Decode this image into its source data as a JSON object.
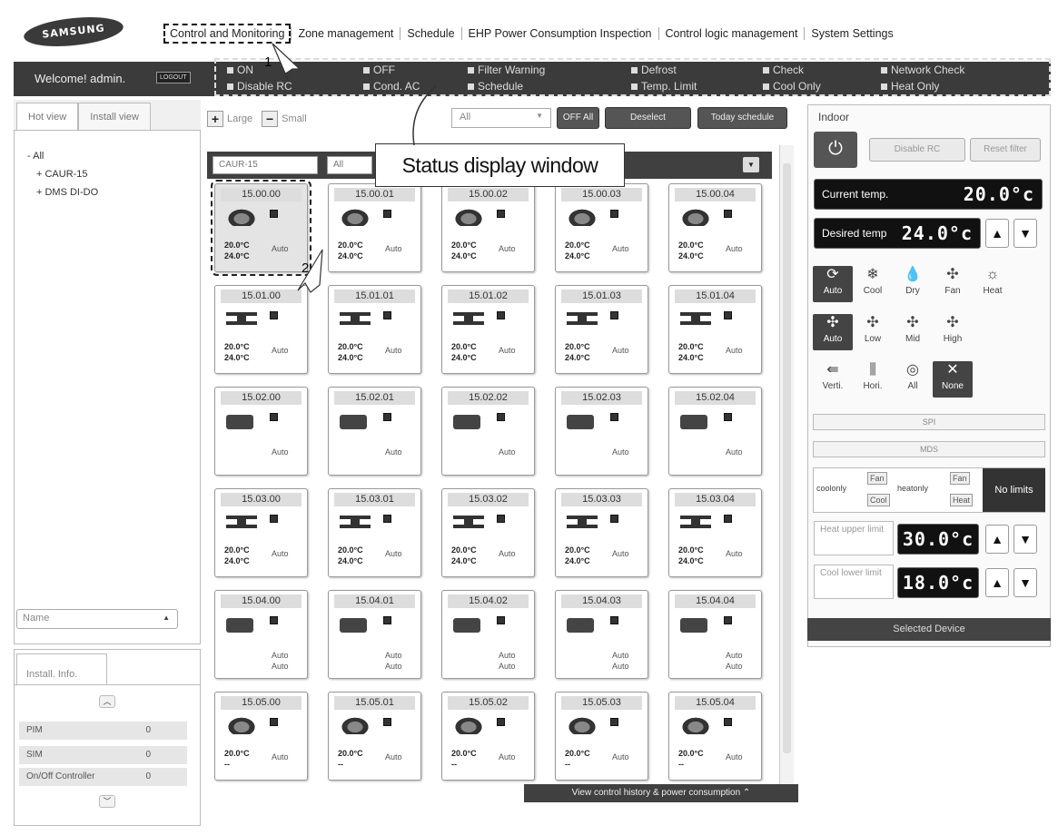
{
  "brand": "SAMSUNG",
  "nav": [
    "Control and Monitoring",
    "Zone management",
    "Schedule",
    "EHP Power Consumption Inspection",
    "Control logic management",
    "System Settings"
  ],
  "welcome": "Welcome! admin.",
  "logout": "LOGOUT",
  "status_items": [
    "ON",
    "OFF",
    "Filter Warning",
    "Defrost",
    "Check",
    "Network Check",
    "Disable RC",
    "Cond. AC",
    "Schedule",
    "Temp. Limit",
    "Cool Only",
    "Heat Only"
  ],
  "left_tabs": [
    "Hot view",
    "Install view"
  ],
  "tree": [
    "- All",
    "+ CAUR-15",
    "+ DMS DI-DO"
  ],
  "name_select": "Name",
  "info_tab": "Install. Info.",
  "info_rows": [
    {
      "label": "PIM",
      "value": "0"
    },
    {
      "label": "SIM",
      "value": "0"
    },
    {
      "label": "On/Off Controller",
      "value": "0"
    }
  ],
  "toolbar": {
    "large": "Large",
    "small": "Small",
    "filter": "All",
    "off_all": "OFF All",
    "deselect": "Deselect",
    "today": "Today schedule"
  },
  "grid_head": {
    "group": "CAUR-15",
    "filter": "All"
  },
  "callout": "Status display window",
  "markers": [
    "1",
    "2"
  ],
  "rows": [
    {
      "type": "cassette",
      "ids": [
        "15.00.00",
        "15.00.01",
        "15.00.02",
        "15.00.03",
        "15.00.04"
      ],
      "t1": "20.0°C",
      "t2": "24.0°C",
      "mode": "Auto",
      "mode2": ""
    },
    {
      "type": "duct",
      "ids": [
        "15.01.00",
        "15.01.01",
        "15.01.02",
        "15.01.03",
        "15.01.04"
      ],
      "t1": "20.0°C",
      "t2": "24.0°C",
      "mode": "Auto",
      "mode2": ""
    },
    {
      "type": "ceiling",
      "ids": [
        "15.02.00",
        "15.02.01",
        "15.02.02",
        "15.02.03",
        "15.02.04"
      ],
      "t1": "",
      "t2": "",
      "mode": "Auto",
      "mode2": ""
    },
    {
      "type": "duct",
      "ids": [
        "15.03.00",
        "15.03.01",
        "15.03.02",
        "15.03.03",
        "15.03.04"
      ],
      "t1": "20.0°C",
      "t2": "24.0°C",
      "mode": "Auto",
      "mode2": ""
    },
    {
      "type": "ceiling",
      "ids": [
        "15.04.00",
        "15.04.01",
        "15.04.02",
        "15.04.03",
        "15.04.04"
      ],
      "t1": "",
      "t2": "",
      "mode": "Auto",
      "mode2": "Auto"
    },
    {
      "type": "cassette",
      "ids": [
        "15.05.00",
        "15.05.01",
        "15.05.02",
        "15.05.03",
        "15.05.04"
      ],
      "t1": "20.0°C",
      "t2": "--",
      "mode": "Auto",
      "mode2": ""
    }
  ],
  "history": "View control history & power consumption",
  "indoor": {
    "title": "Indoor",
    "disable_rc": "Disable RC",
    "reset_filter": "Reset filter",
    "current_label": "Current temp.",
    "current": "20.0°c",
    "desired_label": "Desired temp",
    "desired": "24.0°c",
    "modes": [
      "Auto",
      "Cool",
      "Dry",
      "Fan",
      "Heat"
    ],
    "fans": [
      "Auto",
      "Low",
      "Mid",
      "High"
    ],
    "swings": [
      "Verti.",
      "Hori.",
      "All",
      "None"
    ],
    "spi": "SPI",
    "mds": "MDS",
    "coolonly": "coolonly",
    "heatonly": "heatonly",
    "fan": "Fan",
    "cool": "Cool",
    "heat": "Heat",
    "nolimits": "No limits",
    "heat_upper": "Heat upper limit",
    "heat_upper_val": "30.0°c",
    "cool_lower": "Cool lower limit",
    "cool_lower_val": "18.0°c",
    "selected_device": "Selected Device"
  }
}
